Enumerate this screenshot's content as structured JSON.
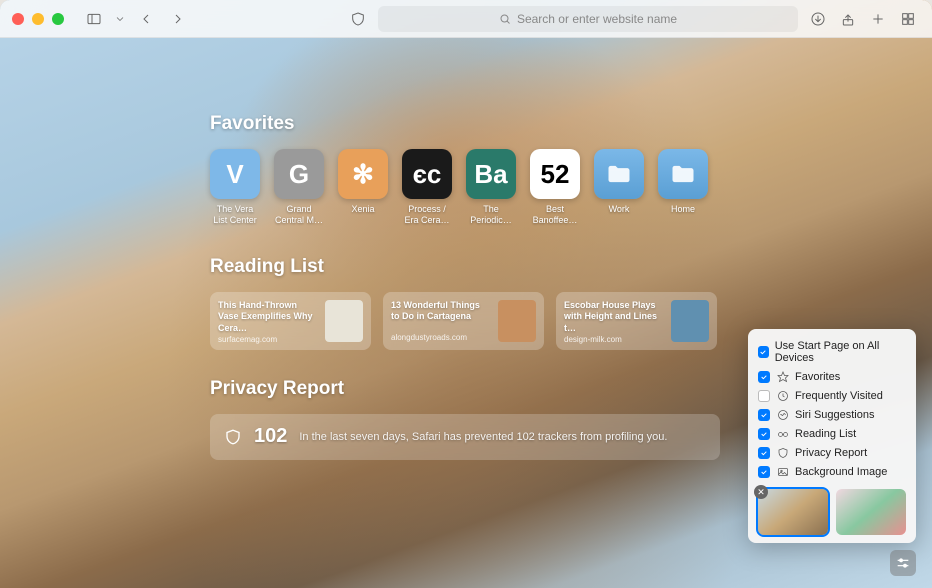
{
  "toolbar": {
    "search_placeholder": "Search or enter website name"
  },
  "sections": {
    "favorites_title": "Favorites",
    "reading_list_title": "Reading List",
    "privacy_title": "Privacy Report"
  },
  "favorites": [
    {
      "label": "The Vera List Center",
      "letter": "V",
      "bg": "#7eb8e8"
    },
    {
      "label": "Grand Central M…",
      "letter": "G",
      "bg": "#9a9a9a"
    },
    {
      "label": "Xenia",
      "letter": "✻",
      "bg": "#e8a05a"
    },
    {
      "label": "Process / Era Cera…",
      "letter": "єс",
      "bg": "#1a1a1a"
    },
    {
      "label": "The Periodic…",
      "letter": "Ba",
      "bg": "#2a7a6a"
    },
    {
      "label": "Best Banoffee…",
      "letter": "52",
      "bg": "#ffffff"
    },
    {
      "label": "Work",
      "letter": "",
      "bg": "folder"
    },
    {
      "label": "Home",
      "letter": "",
      "bg": "folder"
    }
  ],
  "reading_list": [
    {
      "title": "This Hand-Thrown Vase Exemplifies Why Cera…",
      "source": "surfacemag.com",
      "thumb": "#e8e4d8"
    },
    {
      "title": "13 Wonderful Things to Do in Cartagena",
      "source": "alongdustyroads.com",
      "thumb": "#c89060"
    },
    {
      "title": "Escobar House Plays with Height and Lines t…",
      "source": "design-milk.com",
      "thumb": "#6090b0"
    }
  ],
  "privacy": {
    "count": "102",
    "text": "In the last seven days, Safari has prevented 102 trackers from profiling you."
  },
  "settings": {
    "options": [
      {
        "label": "Use Start Page on All Devices",
        "checked": true,
        "icon": ""
      },
      {
        "label": "Favorites",
        "checked": true,
        "icon": "star"
      },
      {
        "label": "Frequently Visited",
        "checked": false,
        "icon": "clock"
      },
      {
        "label": "Siri Suggestions",
        "checked": true,
        "icon": "siri"
      },
      {
        "label": "Reading List",
        "checked": true,
        "icon": "glasses"
      },
      {
        "label": "Privacy Report",
        "checked": true,
        "icon": "shield"
      },
      {
        "label": "Background Image",
        "checked": true,
        "icon": "image"
      }
    ]
  }
}
